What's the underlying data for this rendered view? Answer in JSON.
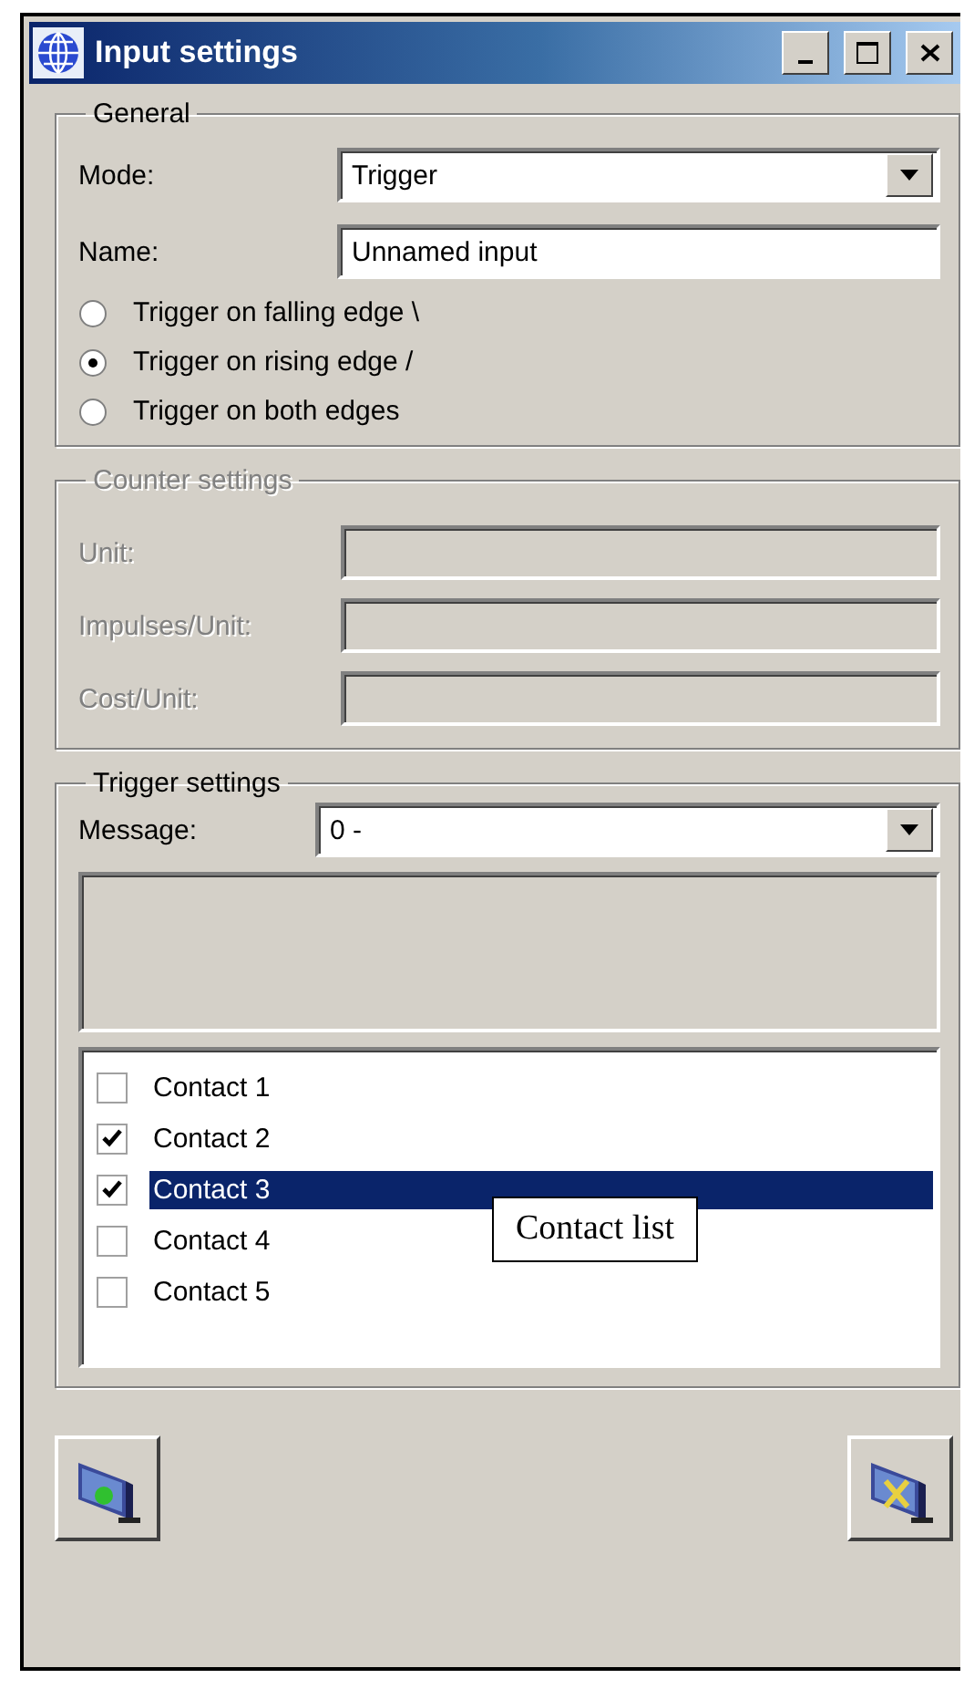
{
  "window": {
    "title": "Input settings"
  },
  "general": {
    "title": "General",
    "mode": {
      "label": "Mode:",
      "value": "Trigger"
    },
    "name": {
      "label": "Name:",
      "value": "Unnamed input"
    },
    "options": [
      {
        "label": "Trigger on falling edge \\",
        "selected": false
      },
      {
        "label": "Trigger on rising edge /",
        "selected": true
      },
      {
        "label": "Trigger on both edges",
        "selected": false
      }
    ]
  },
  "counter": {
    "title": "Counter settings",
    "disabled": true,
    "fields": [
      {
        "label": "Unit:"
      },
      {
        "label": "Impulses/Unit:"
      },
      {
        "label": "Cost/Unit:"
      }
    ]
  },
  "trigger": {
    "title": "Trigger settings",
    "message": {
      "label": "Message:",
      "value": "0 -"
    },
    "contacts": [
      {
        "label": "Contact 1",
        "checked": false,
        "selected": false
      },
      {
        "label": "Contact 2",
        "checked": true,
        "selected": false
      },
      {
        "label": "Contact 3",
        "checked": true,
        "selected": true
      },
      {
        "label": "Contact 4",
        "checked": false,
        "selected": false
      },
      {
        "label": "Contact 5",
        "checked": false,
        "selected": false
      }
    ]
  },
  "annotation": {
    "text": "Contact list"
  }
}
